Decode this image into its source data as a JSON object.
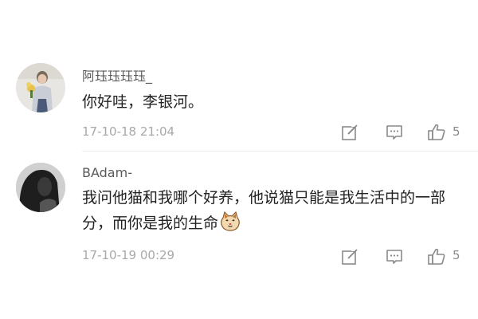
{
  "comments": [
    {
      "username": "阿珏珏珏珏_",
      "text": "你好哇，李银河。",
      "timestamp": "17-10-18 21:04",
      "likes": "5"
    },
    {
      "username": "BAdam-",
      "text": "我问他猫和我哪个好养，他说猫只能是我生活中的一部分，而你是我的生命",
      "emoji": "cat-face-emoji",
      "timestamp": "17-10-19 00:29",
      "likes": "5"
    }
  ],
  "colors": {
    "username": "#5a5a5a",
    "text": "#222222",
    "meta": "#a8a8a8",
    "icon": "#8a8a8a",
    "divider": "#ececec"
  },
  "icons": [
    "edit-icon",
    "comment-icon",
    "thumbs-up-icon"
  ]
}
